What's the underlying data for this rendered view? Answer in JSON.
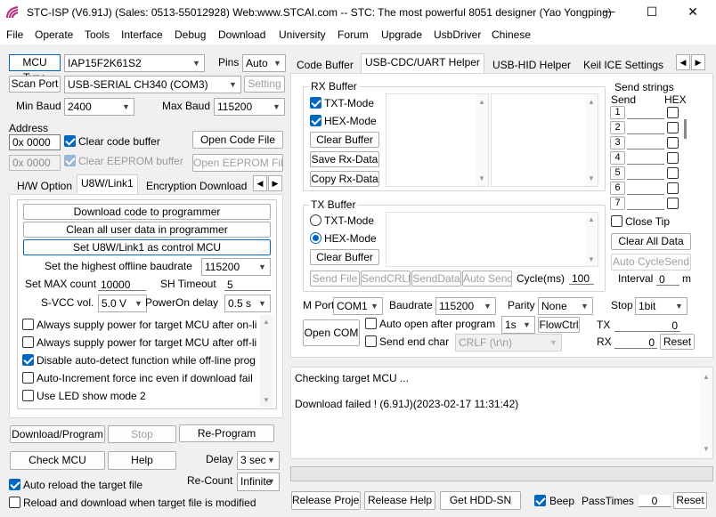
{
  "window": {
    "title": "STC-ISP (V6.91J) (Sales: 0513-55012928) Web:www.STCAI.com  -- STC: The most powerful 8051 designer (Yao Yongping)",
    "minimize": "—",
    "maximize": "☐",
    "close": "✕"
  },
  "menu": [
    "File",
    "Operate",
    "Tools",
    "Interface",
    "Debug",
    "Download",
    "University",
    "Forum",
    "Upgrade",
    "UsbDriver",
    "Chinese"
  ],
  "left": {
    "mcu_type_label": "MCU Type",
    "mcu_type_value": "IAP15F2K61S2",
    "pins_label": "Pins",
    "pins_value": "Auto",
    "scan_port_label": "Scan Port",
    "port_value": "USB-SERIAL CH340 (COM3)",
    "setting_label": "Setting",
    "min_baud_label": "Min Baud",
    "min_baud_value": "2400",
    "max_baud_label": "Max Baud",
    "max_baud_value": "115200",
    "address_label": "Address",
    "addr1": "0x 0000",
    "addr2": "0x 0000",
    "clear_code_buffer": "Clear code buffer",
    "clear_eeprom_buffer": "Clear EEPROM buffer",
    "open_code_file": "Open Code File",
    "open_eeprom_file": "Open EEPROM File",
    "tabs": [
      "H/W Option",
      "U8W/Link1",
      "Encryption Download"
    ],
    "tab_arrow_left": "◀",
    "tab_arrow_right": "▶",
    "u8w": {
      "btn_download_to_programmer": "Download code to programmer",
      "btn_clear_user_data": "Clean all user data in programmer",
      "btn_set_control": "Set U8W/Link1 as control MCU",
      "highest_baud_label": "Set the highest offline baudrate",
      "highest_baud_value": "115200",
      "max_count_label": "Set MAX count",
      "max_count_value": "10000",
      "sh_timeout_label": "SH Timeout",
      "sh_timeout_value": "5",
      "svcc_label": "S-VCC vol.",
      "svcc_value": "5.0 V",
      "poweron_label": "PowerOn delay",
      "poweron_value": "0.5 s",
      "options": [
        {
          "label": "Always supply power for target MCU after on-li",
          "checked": false
        },
        {
          "label": "Always supply power for target MCU after off-li",
          "checked": false
        },
        {
          "label": "Disable auto-detect function while off-line prog",
          "checked": true
        },
        {
          "label": "Auto-Increment force inc even if download fail",
          "checked": false
        },
        {
          "label": "Use LED show mode 2",
          "checked": false
        }
      ]
    },
    "download_program": "Download/Program",
    "stop": "Stop",
    "re_program": "Re-Program",
    "check_mcu": "Check MCU",
    "help": "Help",
    "delay_label": "Delay",
    "delay_value": "3 sec",
    "auto_reload": "Auto reload the target file",
    "recount_label": "Re-Count",
    "recount_value": "Infinite",
    "reload_download": "Reload and download when target file is modified"
  },
  "right": {
    "tabs": [
      "Code Buffer",
      "USB-CDC/UART Helper",
      "USB-HID Helper",
      "Keil ICE Settings"
    ],
    "tab_arrow_left": "◀",
    "tab_arrow_right": "▶",
    "rx_buffer": "RX Buffer",
    "txt_mode": "TXT-Mode",
    "hex_mode": "HEX-Mode",
    "clear_buffer": "Clear Buffer",
    "save_rx_data": "Save Rx-Data",
    "copy_rx_data": "Copy Rx-Data",
    "tx_buffer": "TX Buffer",
    "send_file": "Send File",
    "send_crlf": "SendCRLF",
    "send_data": "SendData",
    "auto_send": "Auto Send",
    "cycle_label": "Cycle(ms)",
    "cycle_value": "100",
    "send_strings": "Send strings",
    "send_col": "Send",
    "hex_col": "HEX",
    "string_rows": [
      "1",
      "2",
      "3",
      "4",
      "5",
      "6",
      "7"
    ],
    "close_tip": "Close Tip",
    "clear_all_data": "Clear All Data",
    "auto_cycle_send": "Auto CycleSend",
    "interval_label": "Interval",
    "interval_value": "0",
    "interval_unit": "m",
    "com_port_label": "M Port",
    "com_port_value": "COM1",
    "baudrate_label": "Baudrate",
    "baudrate_value": "115200",
    "parity_label": "Parity",
    "parity_value": "None",
    "stop_label": "Stop",
    "stop_value": "1bit",
    "open_com": "Open COM",
    "auto_open_label": "Auto open after program",
    "auto_open_value": "1s",
    "flowctrl": "FlowCtrl",
    "tx_label": "TX",
    "tx_value": "0",
    "rx_label": "RX",
    "rx_value": "0",
    "reset": "Reset",
    "send_end_char": "Send end char",
    "end_char_value": "CRLF (\\r\\n)"
  },
  "log": {
    "line1": "Checking target MCU ...",
    "line2": "Download failed ! (6.91J)(2023-02-17 11:31:42)"
  },
  "bottom": {
    "release_project": "Release Project",
    "release_help": "Release Help",
    "get_hdd_sn": "Get HDD-SN",
    "beep": "Beep",
    "pass_times_label": "PassTimes",
    "pass_times_value": "0",
    "reset": "Reset"
  }
}
